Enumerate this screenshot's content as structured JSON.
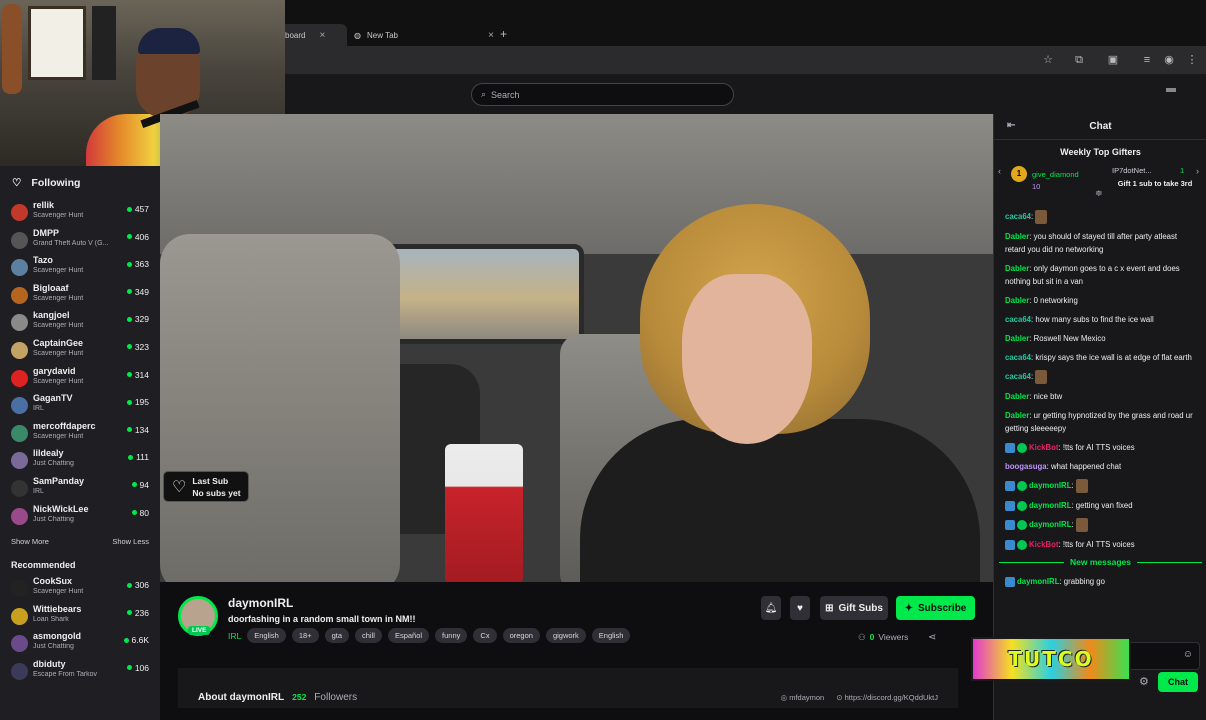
{
  "browser": {
    "tabs": [
      {
        "label": "board"
      },
      {
        "label": "New Tab"
      }
    ],
    "new_tab": "+",
    "close": "×"
  },
  "topnav": {
    "search_placeholder": "Search"
  },
  "sidebar": {
    "following_label": "Following",
    "channels": [
      {
        "name": "rellik",
        "game": "Scavenger Hunt",
        "viewers": "457",
        "color": "#c0392b"
      },
      {
        "name": "DMPP",
        "game": "Grand Theft Auto V (G...",
        "viewers": "406",
        "color": "#555"
      },
      {
        "name": "Tazo",
        "game": "Scavenger Hunt",
        "viewers": "363",
        "color": "#5d7fa0"
      },
      {
        "name": "Bigloaaf",
        "game": "Scavenger Hunt",
        "viewers": "349",
        "color": "#b5651d"
      },
      {
        "name": "kangjoel",
        "game": "Scavenger Hunt",
        "viewers": "329",
        "color": "#8a8a8a"
      },
      {
        "name": "CaptainGee",
        "game": "Scavenger Hunt",
        "viewers": "323",
        "color": "#c4a265"
      },
      {
        "name": "garydavid",
        "game": "Scavenger Hunt",
        "viewers": "314",
        "color": "#d22"
      },
      {
        "name": "GaganTV",
        "game": "IRL",
        "viewers": "195",
        "color": "#4a6fa5"
      },
      {
        "name": "mercoffdaperc",
        "game": "Scavenger Hunt",
        "viewers": "134",
        "color": "#3a8a6a"
      },
      {
        "name": "lildealy",
        "game": "Just Chatting",
        "viewers": "111",
        "color": "#7a6a9a"
      },
      {
        "name": "SamPanday",
        "game": "IRL",
        "viewers": "94",
        "color": "#333"
      },
      {
        "name": "NickWickLee",
        "game": "Just Chatting",
        "viewers": "80",
        "color": "#9a4a8a"
      }
    ],
    "show_more": "Show More",
    "show_less": "Show Less",
    "recommended_label": "Recommended",
    "recommended": [
      {
        "name": "CookSux",
        "game": "Scavenger Hunt",
        "viewers": "306",
        "color": "#222"
      },
      {
        "name": "Wittiebears",
        "game": "Loan Shark",
        "viewers": "236",
        "color": "#c8a020"
      },
      {
        "name": "asmongold",
        "game": "Just Chatting",
        "viewers": "6.6K",
        "color": "#6a4a8a"
      },
      {
        "name": "dbiduty",
        "game": "Escape From Tarkov",
        "viewers": "106",
        "color": "#3a3a5a"
      }
    ]
  },
  "stream": {
    "last_sub_title": "Last Sub",
    "last_sub_value": "No subs yet",
    "channel_name": "daymonIRL",
    "live_label": "LIVE",
    "title": "doorfashing in a random small town in NM!!",
    "category": "IRL",
    "tags": [
      "English",
      "18+",
      "gta",
      "chill",
      "Español",
      "funny",
      "Cx",
      "oregon",
      "gigwork",
      "English"
    ],
    "gift_subs_label": "Gift Subs",
    "subscribe_label": "Subscribe",
    "viewers_count": "0",
    "viewers_label": "Viewers",
    "about_label": "About daymonIRL",
    "followers_count": "252",
    "followers_label": "Followers",
    "link_twitter": "mfdaymon",
    "link_discord": "https://discord.gg/KQddUktJ"
  },
  "chat": {
    "title": "Chat",
    "gifters_title": "Weekly Top Gifters",
    "gifter1_name": "give_diamond",
    "gifter1_count": "10",
    "gifter2_name": "IP7dotNet...",
    "gifter2_count": "1",
    "gifter_cta": "Gift 1 sub to take 3rd",
    "messages": [
      {
        "user": "caca64",
        "color": "#1fc9a0",
        "text": "",
        "emote": true
      },
      {
        "user": "Dabler",
        "color": "#00e94b",
        "text": "you should of stayed till after party atleast retard you did no networking"
      },
      {
        "user": "Dabler",
        "color": "#00e94b",
        "text": "only daymon goes to a c x event and does nothing but sit in a van"
      },
      {
        "user": "Dabler",
        "color": "#00e94b",
        "text": "0 networking"
      },
      {
        "user": "caca64",
        "color": "#1fc9a0",
        "text": "how many subs to find the ice wall"
      },
      {
        "user": "Dabler",
        "color": "#00e94b",
        "text": "Roswell New Mexico"
      },
      {
        "user": "caca64",
        "color": "#1fc9a0",
        "text": "krispy says the ice wall is at edge of flat earth"
      },
      {
        "user": "caca64",
        "color": "#1fc9a0",
        "text": "",
        "emote": true
      },
      {
        "user": "Dabler",
        "color": "#00e94b",
        "text": "nice btw"
      },
      {
        "user": "Dabler",
        "color": "#00e94b",
        "text": "ur getting hypnotized by the grass and road ur getting sleeeeepy"
      },
      {
        "user": "KickBot",
        "color": "#e91e63",
        "text": "!tts for AI TTS voices",
        "badges": true
      },
      {
        "user": "boogasuga",
        "color": "#bf94ff",
        "text": "what happened chat"
      },
      {
        "user": "daymonIRL",
        "color": "#00e94b",
        "text": "",
        "emote": true,
        "badges": true
      },
      {
        "user": "daymonIRL",
        "color": "#00e94b",
        "text": "getting van fixed",
        "badges": true
      },
      {
        "user": "daymonIRL",
        "color": "#00e94b",
        "text": "",
        "emote": true,
        "badges": true
      },
      {
        "user": "KickBot",
        "color": "#e91e63",
        "text": "!tts for AI TTS voices",
        "badges": true
      }
    ],
    "new_messages_label": "New messages",
    "last_message": {
      "user": "daymonIRL",
      "text": "grabbing go"
    },
    "overlay_text": "TUTCO",
    "send_label": "Chat"
  }
}
